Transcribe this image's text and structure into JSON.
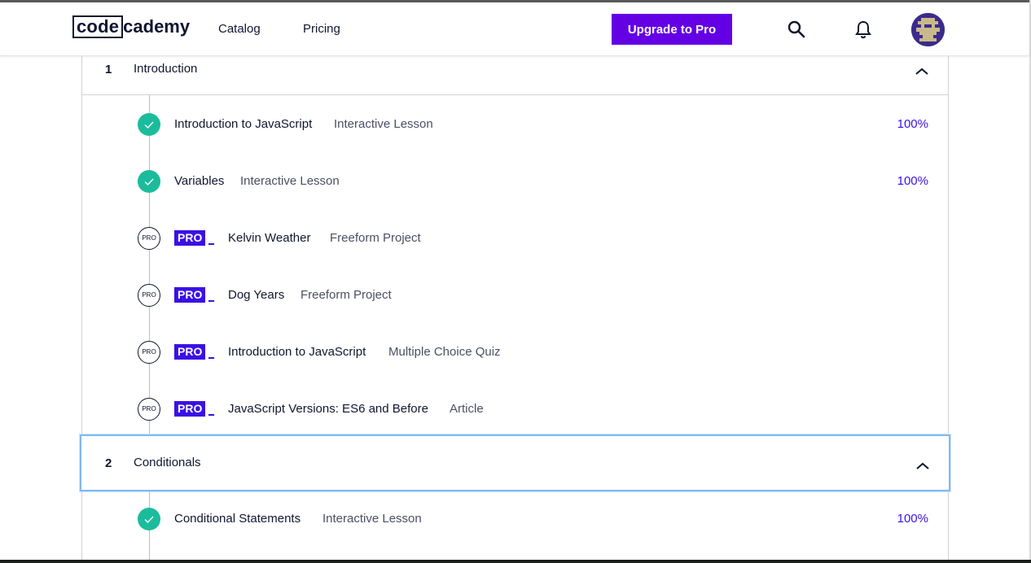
{
  "header": {
    "logo_left": "code",
    "logo_right": "cademy",
    "nav": [
      "Catalog",
      "Pricing"
    ],
    "upgrade_label": "Upgrade to Pro",
    "icons": [
      "search-icon",
      "bell-icon",
      "avatar"
    ]
  },
  "colors": {
    "accent": "#6400e4",
    "pro": "#3a10e5",
    "complete": "#1bbc9c",
    "focus": "#7fb9f5"
  },
  "sections": [
    {
      "number": "1",
      "title": "Introduction",
      "lessons": [
        {
          "title": "Introduction to JavaScript",
          "type": "Interactive Lesson",
          "progress": "100%",
          "status": "complete"
        },
        {
          "title": "Variables",
          "type": "Interactive Lesson",
          "progress": "100%",
          "status": "complete"
        },
        {
          "title": "Kelvin Weather",
          "type": "Freeform Project",
          "progress": "",
          "status": "pro"
        },
        {
          "title": "Dog Years",
          "type": "Freeform Project",
          "progress": "",
          "status": "pro"
        },
        {
          "title": "Introduction to JavaScript",
          "type": "Multiple Choice Quiz",
          "progress": "",
          "status": "pro"
        },
        {
          "title": "JavaScript Versions: ES6 and Before",
          "type": "Article",
          "progress": "",
          "status": "pro"
        }
      ]
    },
    {
      "number": "2",
      "title": "Conditionals",
      "lessons": [
        {
          "title": "Conditional Statements",
          "type": "Interactive Lesson",
          "progress": "100%",
          "status": "complete"
        }
      ]
    }
  ],
  "labels": {
    "pro_badge": "PRO",
    "pro_circle": "PRO"
  }
}
